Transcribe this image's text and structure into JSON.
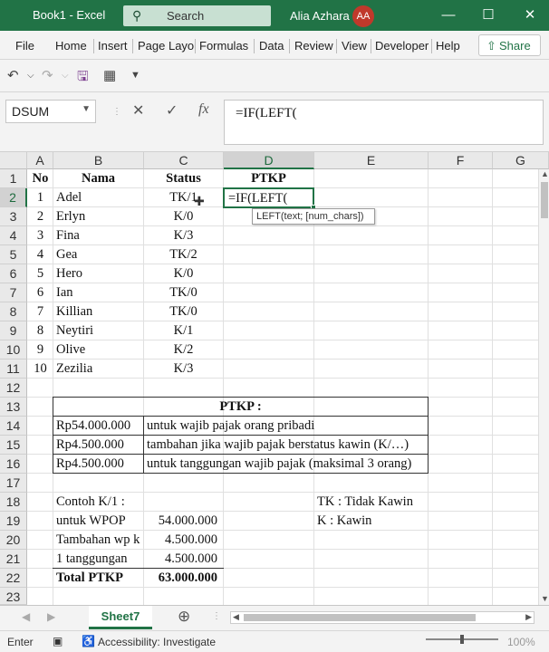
{
  "titlebar": {
    "book": "Book1 - Excel",
    "search_placeholder": "Search",
    "user_name": "Alia Azhara",
    "user_initials": "AA"
  },
  "ribbon_tabs": [
    "File",
    "Home",
    "Insert",
    "Page Layo",
    "Formulas",
    "Data",
    "Review",
    "View",
    "Developer",
    "Help"
  ],
  "share_label": "Share",
  "name_box": "DSUM",
  "formula": "=IF(LEFT(",
  "columns": [
    "A",
    "B",
    "C",
    "D",
    "E",
    "F",
    "G"
  ],
  "rows": [
    "1",
    "2",
    "3",
    "4",
    "5",
    "6",
    "7",
    "8",
    "9",
    "10",
    "11",
    "12",
    "13",
    "14",
    "15",
    "16",
    "17",
    "18",
    "19",
    "20",
    "21",
    "22",
    "23"
  ],
  "headers": {
    "no": "No",
    "nama": "Nama",
    "status": "Status",
    "ptkp": "PTKP"
  },
  "employees": [
    {
      "no": "1",
      "nama": "Adel",
      "status": "TK/1"
    },
    {
      "no": "2",
      "nama": "Erlyn",
      "status": "K/0"
    },
    {
      "no": "3",
      "nama": "Fina",
      "status": "K/3"
    },
    {
      "no": "4",
      "nama": "Gea",
      "status": "TK/2"
    },
    {
      "no": "5",
      "nama": "Hero",
      "status": "K/0"
    },
    {
      "no": "6",
      "nama": "Ian",
      "status": "TK/0"
    },
    {
      "no": "7",
      "nama": "Killian",
      "status": "TK/0"
    },
    {
      "no": "8",
      "nama": "Neytiri",
      "status": "K/1"
    },
    {
      "no": "9",
      "nama": "Olive",
      "status": "K/2"
    },
    {
      "no": "10",
      "nama": "Zezilia",
      "status": "K/3"
    }
  ],
  "active_cell_text": "=IF(LEFT(",
  "tooltip": "LEFT(text; [num_chars])",
  "ptkp_table": {
    "title": "PTKP :",
    "rows": [
      {
        "amount": "Rp54.000.000",
        "desc": "untuk wajib pajak orang pribadi"
      },
      {
        "amount": "Rp4.500.000",
        "desc": "tambahan jika wajib pajak berstatus kawin (K/…)"
      },
      {
        "amount": "Rp4.500.000",
        "desc": "untuk tanggungan wajib pajak (maksimal 3 orang)"
      }
    ]
  },
  "example": {
    "title": "Contoh K/1 :",
    "rows": [
      {
        "label": "untuk WPOP",
        "value": "54.000.000"
      },
      {
        "label": "Tambahan wp k",
        "value": "4.500.000"
      },
      {
        "label": "1 tanggungan",
        "value": "4.500.000"
      }
    ],
    "total_label": "Total PTKP",
    "total_value": "63.000.000"
  },
  "legend": {
    "tk": "TK : Tidak Kawin",
    "k": "K : Kawin"
  },
  "sheet_tab": "Sheet7",
  "status": {
    "mode": "Enter",
    "accessibility": "Accessibility: Investigate",
    "zoom": "100%"
  },
  "accent": "#217346"
}
